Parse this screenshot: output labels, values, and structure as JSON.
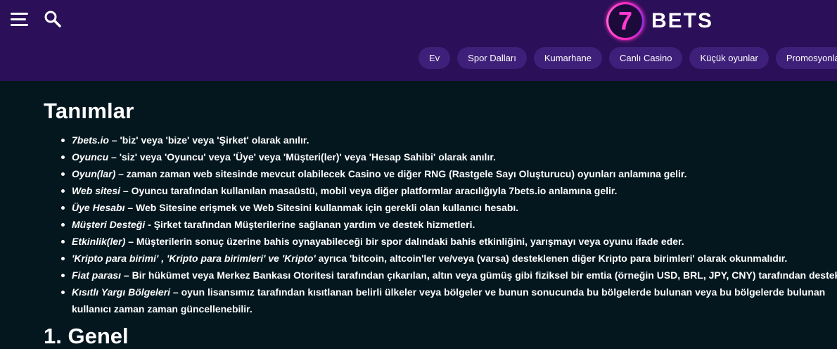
{
  "header": {
    "logo": {
      "digit": "7",
      "text": "BETS"
    },
    "menu_icon": "hamburger-icon",
    "search_icon": "search-icon",
    "nav": [
      "Ev",
      "Spor Dalları",
      "Kumarhane",
      "Canlı Casino",
      "Küçük oyunlar",
      "Promosyonlar"
    ],
    "colors": {
      "header_bg": "#2b0f58",
      "pill_bg": "#3e1f7a",
      "logo_accent": "#ff3ad0"
    }
  },
  "main": {
    "title": "Tanımlar",
    "definitions": [
      {
        "term": "7bets.io",
        "text": " – 'biz' veya 'bize' veya 'Şirket' olarak anılır."
      },
      {
        "term": "Oyuncu",
        "text": " – 'siz' veya 'Oyuncu' veya 'Üye' veya 'Müşteri(ler)' veya 'Hesap Sahibi' olarak anılır."
      },
      {
        "term": "Oyun(lar)",
        "text": " – zaman zaman web sitesinde mevcut olabilecek Casino ve diğer RNG (Rastgele Sayı Oluşturucu) oyunları anlamına gelir."
      },
      {
        "term": "Web sitesi",
        "text": " – Oyuncu tarafından kullanılan masaüstü, mobil veya diğer platformlar aracılığıyla 7bets.io anlamına gelir."
      },
      {
        "term": "Üye Hesabı",
        "text": " – Web Sitesine erişmek ve Web Sitesini kullanmak için gerekli olan kullanıcı hesabı."
      },
      {
        "term": "Müşteri Desteği",
        "text": " - Şirket tarafından Müşterilerine sağlanan yardım ve destek hizmetleri."
      },
      {
        "term": "Etkinlik(ler)",
        "text": " – Müşterilerin sonuç üzerine bahis oynayabileceği bir spor dalındaki bahis etkinliğini, yarışmayı veya oyunu ifade eder."
      },
      {
        "term": "'Kripto para birimi' , 'Kripto para birimleri' ve 'Kripto'",
        "text": " ayrıca 'bitcoin, altcoin'ler ve/veya (varsa) desteklenen diğer Kripto para birimleri' olarak okunmalıdır."
      },
      {
        "term": "Fiat parası",
        "text": " – Bir hükümet veya Merkez Bankası Otoritesi tarafından çıkarılan, altın veya gümüş gibi fiziksel bir emtia (örneğin USD, BRL, JPY, CNY) tarafından desteklenme"
      },
      {
        "term": "Kısıtlı Yargı Bölgeleri",
        "text": " – oyun lisansımız tarafından kısıtlanan belirli ülkeler veya bölgeler ve bunun sonucunda bu bölgelerde bulunan veya bu bölgelerde bulunan kullanıcı zaman zaman güncellenebilir."
      }
    ],
    "next_heading": "1. Genel"
  }
}
